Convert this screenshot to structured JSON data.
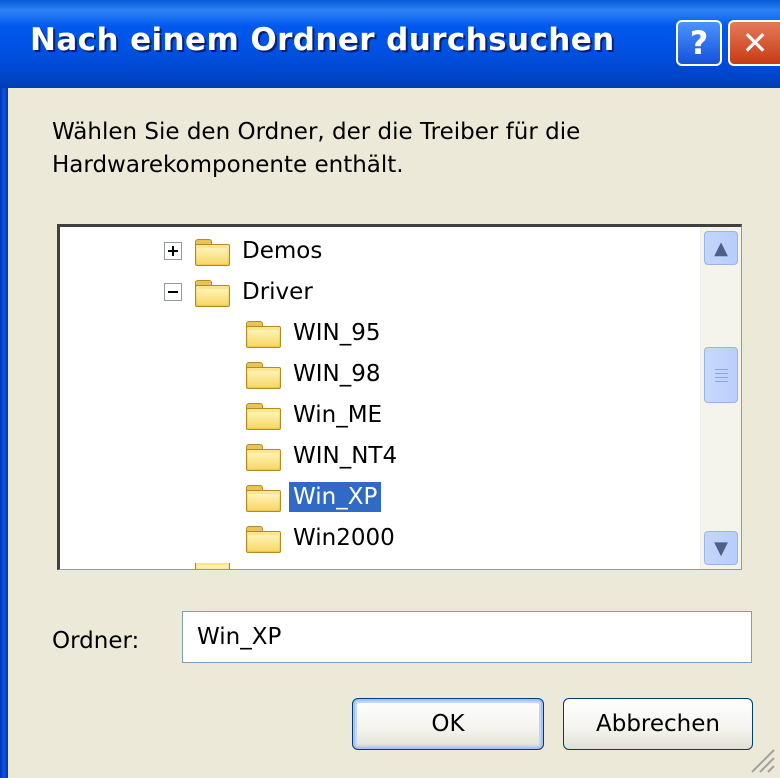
{
  "window": {
    "title": "Nach einem Ordner durchsuchen",
    "help_label": "?",
    "close_label": "✕"
  },
  "description": {
    "line1": "Wählen Sie den Ordner, der die Treiber für die",
    "line2": "Hardwarekomponente enthält."
  },
  "tree": {
    "items": [
      {
        "label": "Demos",
        "expander": "plus",
        "level": 1
      },
      {
        "label": "Driver",
        "expander": "minus",
        "level": 1
      },
      {
        "label": "WIN_95",
        "expander": "none",
        "level": 2
      },
      {
        "label": "WIN_98",
        "expander": "none",
        "level": 2
      },
      {
        "label": "Win_ME",
        "expander": "none",
        "level": 2
      },
      {
        "label": "WIN_NT4",
        "expander": "none",
        "level": 2
      },
      {
        "label": "Win_XP",
        "expander": "none",
        "level": 2,
        "selected": true
      },
      {
        "label": "Win2000",
        "expander": "none",
        "level": 2
      }
    ],
    "scroll_up_symbol": "▲",
    "scroll_down_symbol": "▼"
  },
  "folder_field": {
    "label": "Ordner:",
    "value": "Win_XP"
  },
  "buttons": {
    "ok": "OK",
    "cancel": "Abbrechen"
  },
  "colors": {
    "titlebar": "#0054e3",
    "selection": "#316ac5",
    "dialog_bg": "#ece9d8"
  },
  "icons": {
    "folder": "folder-icon",
    "expand": "plus-box-icon",
    "collapse": "minus-box-icon"
  }
}
